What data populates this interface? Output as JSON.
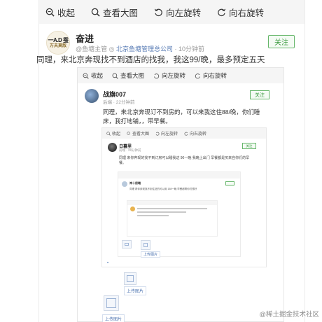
{
  "toolbar": {
    "collapse": "收起",
    "view_large": "查看大图",
    "rotate_left": "向左旋转",
    "rotate_right": "向右旋转"
  },
  "post": {
    "avatar_text_line1": "一A.D 蚕",
    "avatar_text_line2": "万夫莫敌",
    "author": "奋进",
    "meta_prefix": "@鱼塘主管",
    "meta_org": "北京鱼塘管理总公司",
    "meta_time": "10分钟前",
    "follow_label": "关注",
    "text": "同理，来北京奔现找不到酒店的找我，我这99/晚，最多预定五天"
  },
  "quote1": {
    "toolbar": {
      "collapse": "收起",
      "view_large": "查看大图",
      "rotate_left": "向左旋转",
      "rotate_right": "向右旋转"
    },
    "author": "战旗007",
    "meta": "后端 · 22分钟前",
    "follow_label": "关注",
    "text": "同理，来北京奔现订不到房的，可以来我这住88/晚，你们睡床，我打地铺，，带早餐。"
  },
  "quote2": {
    "toolbar": {
      "collapse": "收起",
      "view_large": "查看大图",
      "rotate_left": "向左旋转",
      "rotate_right": "向右旋转"
    },
    "author": "日暮里",
    "meta": "前端 · 29分钟前",
    "follow_label": "关注",
    "text": "同理 来你奔现的找不到订房可以睡我这 90一晚 我晚上出门 早餐都是买来自你们的早餐。"
  },
  "quote3": {
    "author": "神十前端",
    "text": "同理 再你奔现找不到住处的可以用 158一晚 早餐都帮你们想好"
  },
  "images": {
    "label_small": "上传图片",
    "label_upload": "上传图片",
    "label_upload2": "上传图片"
  },
  "watermark": "@稀土掘金技术社区"
}
